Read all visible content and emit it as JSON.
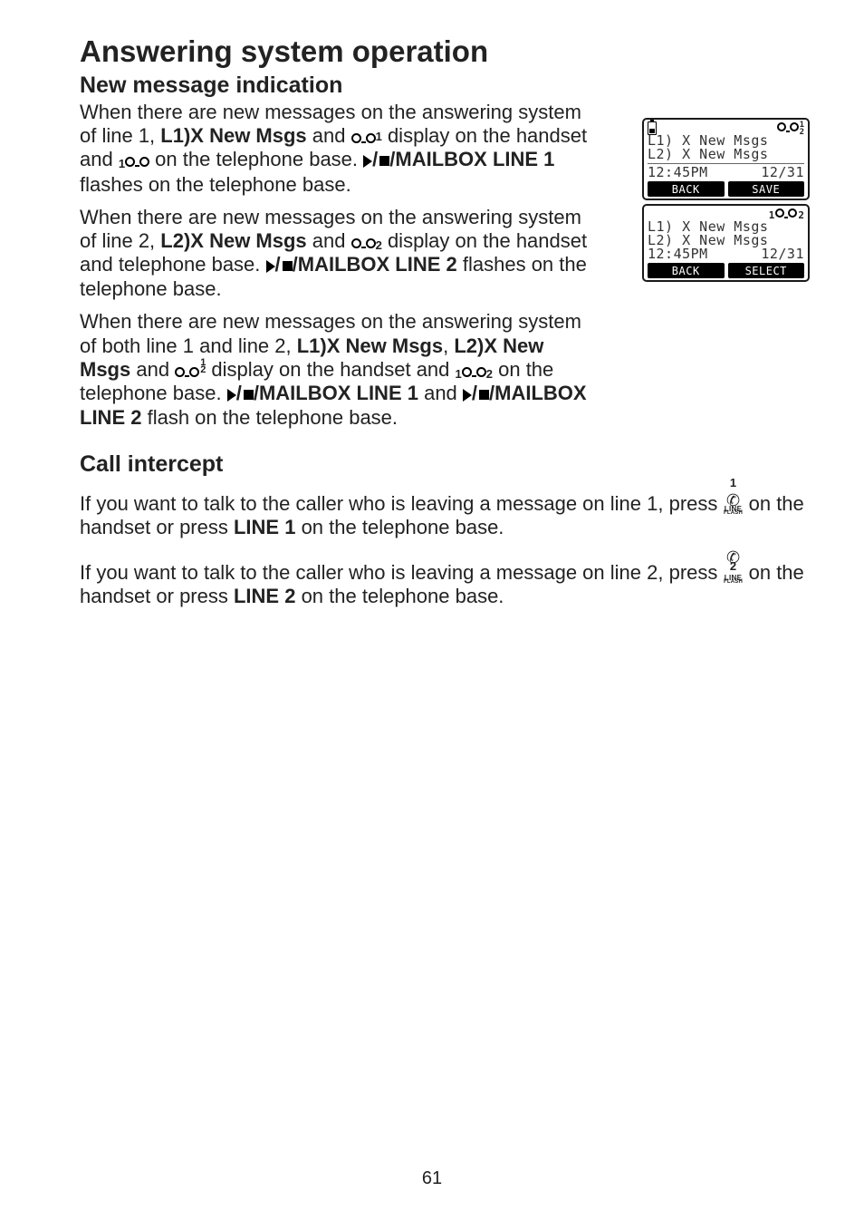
{
  "page_number": "61",
  "title": "Answering system operation",
  "s1_title": "New message indication",
  "p1_a": "When there are new messages on the answering system of line 1, ",
  "p1_b": "L1)X New Msgs",
  "p1_c": " and ",
  "p1_d": " display on the handset and ",
  "p1_e": " on the telephone base. ",
  "p1_f": "/MAILBOX LINE 1",
  "p1_g": " flashes on the telephone base.",
  "p2_a": "When there are new messages on the answering system of line 2, ",
  "p2_b": "L2)X New Msgs",
  "p2_c": " and ",
  "p2_d": " display on the handset and telephone base. ",
  "p2_e": "/MAILBOX LINE 2",
  "p2_f": " flashes on the telephone base.",
  "p3_a": "When there are new messages on the answering system of both line 1 and line 2, ",
  "p3_b": "L1)X New Msgs",
  "p3_c": ", ",
  "p3_d": "L2)X New Msgs",
  "p3_e": " and ",
  "p3_f": " display on the handset and ",
  "p3_g": " on the telephone base. ",
  "p3_h": "MAILBOX LINE 1",
  "p3_i": " and ",
  "p3_j": "MAILBOX LINE 2",
  "p3_k": " flash on the telephone base.",
  "s2_title": "Call intercept",
  "p4_a": "If you want to talk to the caller who is leaving a message on line 1, press ",
  "p4_b": " on the handset or press ",
  "p4_c": "LINE 1",
  "p4_d": " on the telephone base.",
  "p5_a": "If you want to talk to the caller who is leaving a message on line 2, press ",
  "p5_b": " on the handset or press ",
  "p5_c": "LINE 2",
  "p5_d": " on the telephone base.",
  "tape_sup_1": "1",
  "tape_sub_2": "2",
  "tape_pre_1": "1",
  "stack_1": "1",
  "stack_2": "2",
  "linekey1": {
    "num": "1",
    "line": "LINE",
    "flash": "FLASH"
  },
  "linekey2": {
    "num": "2",
    "line": "LINE",
    "flash": "FLASH"
  },
  "lcd1": {
    "l1": "L1) X New Msgs",
    "l2": "L2) X New Msgs",
    "time": "12:45PM",
    "date": "12/31",
    "k1": "BACK",
    "k2": "SAVE"
  },
  "lcd2": {
    "pre": "1",
    "post": "2",
    "l1": "L1) X New Msgs",
    "l2": "L2) X New Msgs",
    "time": "12:45PM",
    "date": "12/31",
    "k1": "BACK",
    "k2": "SELECT"
  }
}
